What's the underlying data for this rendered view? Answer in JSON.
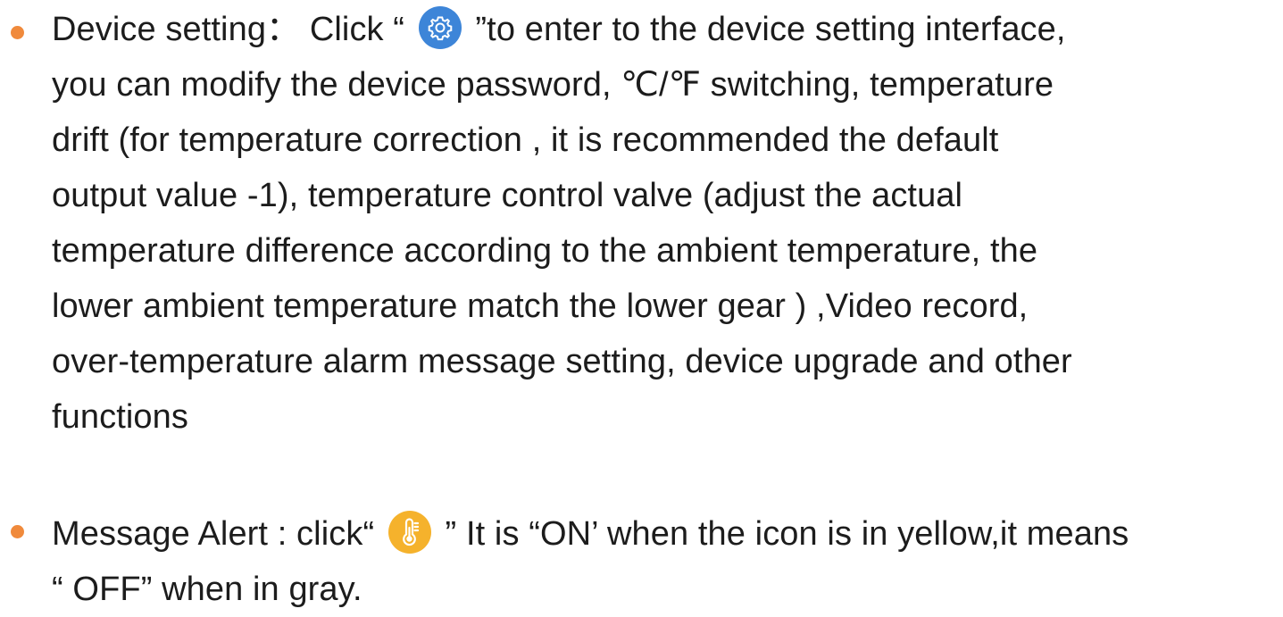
{
  "items": [
    {
      "lines": [
        {
          "before": "Device setting： Click “",
          "after": "”to enter to the device setting interface,"
        },
        "you can modify the device password, ℃/℉ switching, temperature",
        "drift (for temperature correction , it is recommended the default",
        "output value -1), temperature control valve (adjust the actual",
        "temperature difference according to the ambient temperature, the",
        "lower ambient temperature match the lower gear ) ,Video record,",
        "over-temperature alarm message setting, device upgrade and other",
        "functions"
      ],
      "icon": "gear-icon",
      "icon_color": "#3d85d8"
    },
    {
      "lines": [
        {
          "before": "Message Alert : click“",
          "after": "”  It is “ON’ when the icon is in yellow,it means"
        },
        "“ OFF” when in gray."
      ],
      "icon": "thermometer-icon",
      "icon_color": "#f5b22c"
    }
  ],
  "colors": {
    "bullet": "#f08a3c",
    "text": "#1c1c1c"
  }
}
